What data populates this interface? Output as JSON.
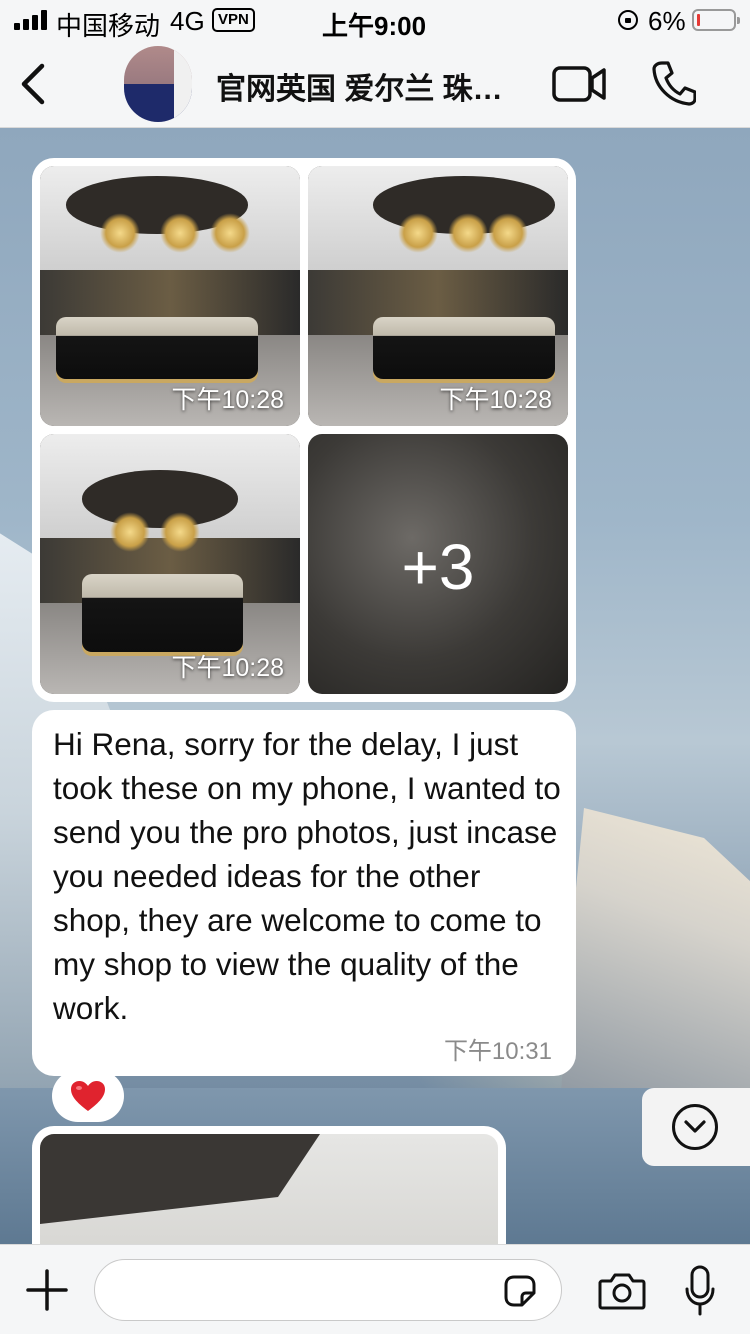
{
  "status_bar": {
    "carrier": "中国移动",
    "network": "4G",
    "vpn": "VPN",
    "time": "上午9:00",
    "battery": "6%"
  },
  "header": {
    "title": "官网英国 爱尔兰 珠…",
    "icons": [
      "back-icon",
      "video-call-icon",
      "phone-call-icon"
    ]
  },
  "messages": {
    "photo_album": {
      "photos": [
        {
          "time": "下午10:28"
        },
        {
          "time": "下午10:28"
        },
        {
          "time": "下午10:28"
        }
      ],
      "more_count": "+3"
    },
    "text_message": {
      "text": "Hi Rena, sorry for the delay, I just took these on my phone, I wanted to send you the pro photos, just incase you needed ideas for the other shop, they are welcome to come to my shop to view the quality of the work.",
      "time": "下午10:31"
    },
    "reaction": "heart"
  },
  "input_bar": {
    "placeholder": "",
    "icons": [
      "plus-icon",
      "sticker-icon",
      "camera-icon",
      "microphone-icon"
    ]
  },
  "colors": {
    "bubble": "#ffffff",
    "bar_background": "#f5f6f7",
    "battery_low": "#e53935",
    "heart": "#e0232e"
  }
}
